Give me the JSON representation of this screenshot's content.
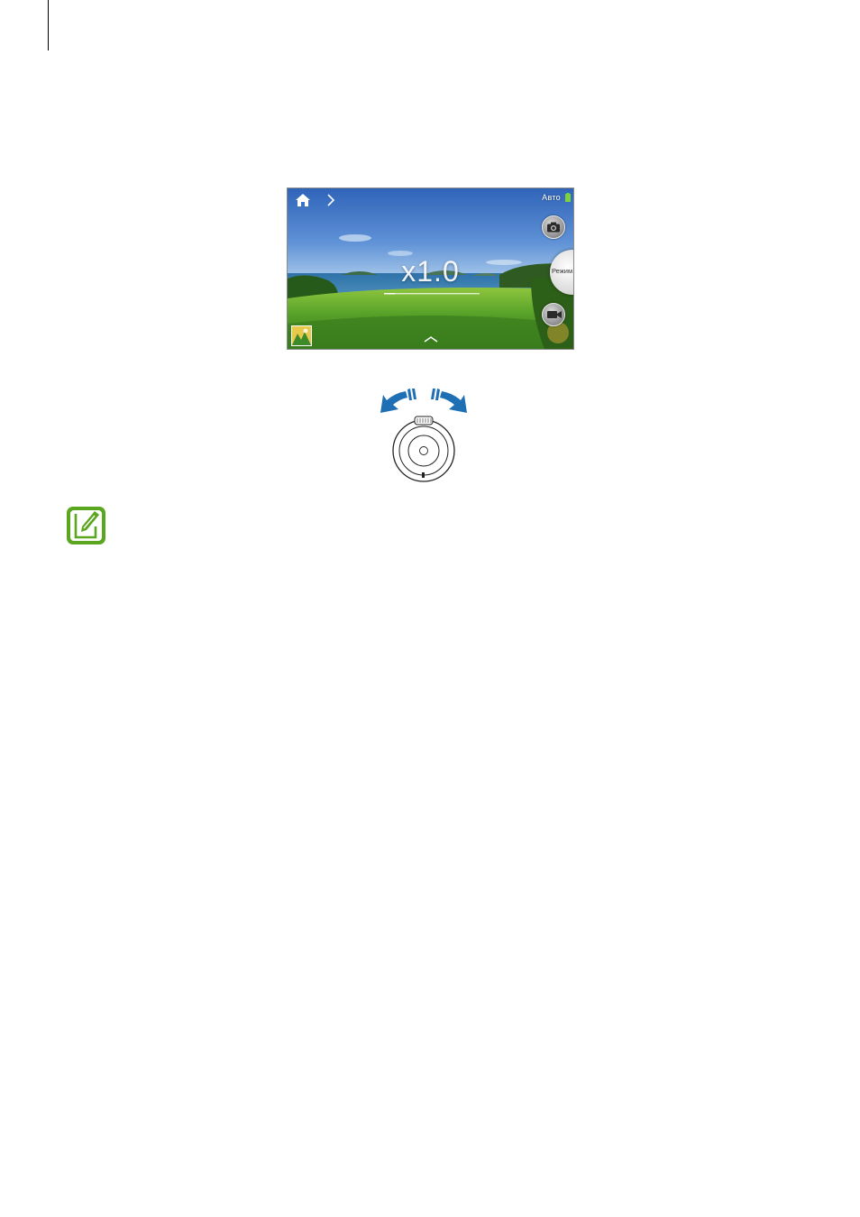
{
  "camera_screen": {
    "mode_label": "Авто",
    "zoom_level": "x1.0",
    "mode_dial_label": "Режим",
    "icons": {
      "home": "home-icon",
      "next": "chevron-right-icon",
      "battery": "battery-icon",
      "photo": "camera-icon",
      "video": "video-camera-icon",
      "gallery": "gallery-thumbnail",
      "expand": "chevron-up-icon"
    },
    "colors": {
      "sky": "#3f73c6",
      "grass": "#5aa82a",
      "battery": "#7dd23c"
    }
  },
  "illustration": {
    "arrows_color": "#1f6fb4",
    "icon": "zoom-dial-rotate-icon"
  },
  "note": {
    "icon": "note-pencil-icon",
    "color": "#5aa61f"
  }
}
